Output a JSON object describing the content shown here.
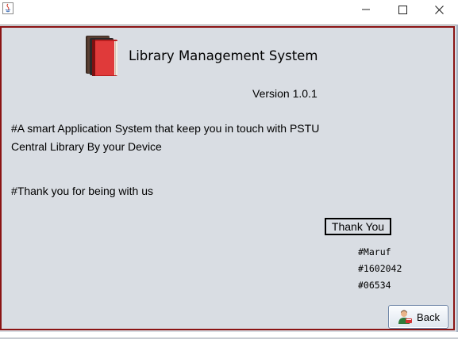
{
  "window": {
    "minimize_glyph": "—",
    "maximize_glyph": "☐",
    "close_glyph": "✕"
  },
  "header": {
    "title": "Library Management System",
    "version": "Version 1.0.1",
    "logo_icon": "books-icon"
  },
  "body": {
    "description_line1": "#A smart Application System that keep you in touch with PSTU",
    "description_line2": "Central Library By your Device",
    "thanks_message": "#Thank you for being with us"
  },
  "thank_you_button": {
    "label": "Thank You"
  },
  "credits": {
    "name": "#Maruf",
    "id": "#1602042",
    "code": "#06534"
  },
  "back_button": {
    "label": "Back",
    "icon": "user-icon"
  },
  "colors": {
    "frame_border": "#8b1414",
    "panel_background": "#d9dde3",
    "book_red": "#d62e2e"
  }
}
